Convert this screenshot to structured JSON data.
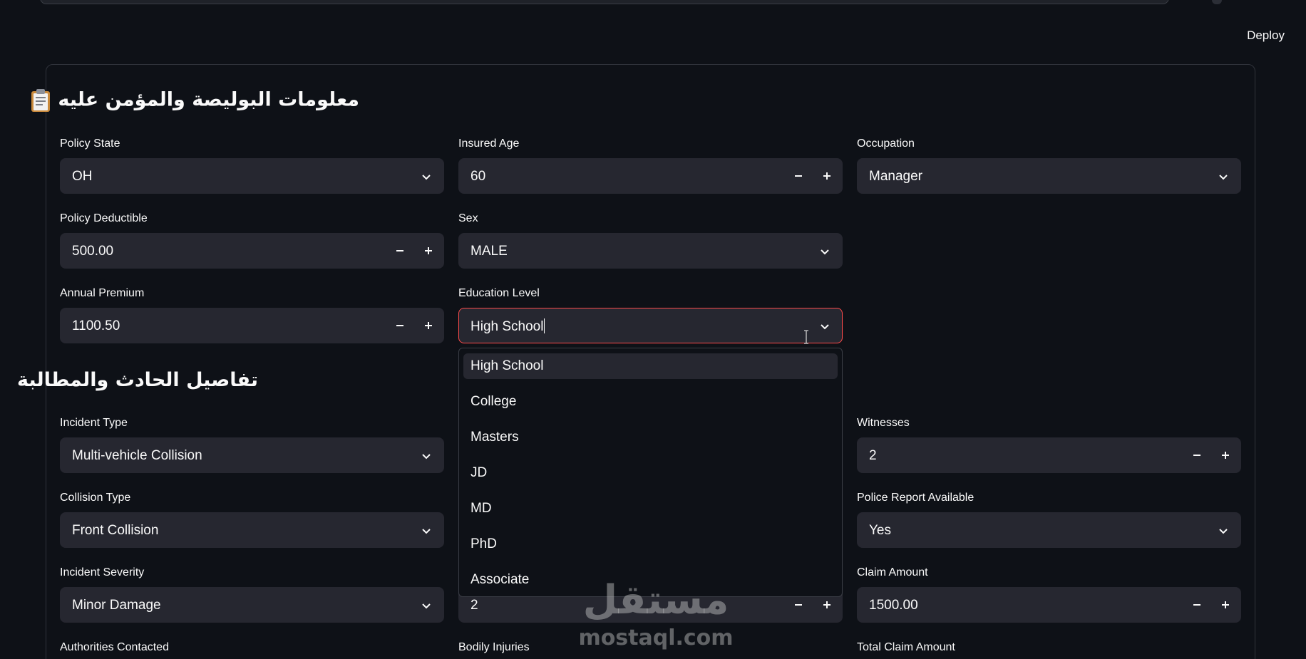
{
  "header": {
    "deploy_label": "Deploy"
  },
  "section1": {
    "title": "معلومات البوليصة والمؤمن عليه",
    "icon": "clipboard-icon"
  },
  "section2": {
    "title": "تفاصيل الحادث والمطالبة"
  },
  "fields": {
    "policy_state": {
      "label": "Policy State",
      "value": "OH"
    },
    "insured_age": {
      "label": "Insured Age",
      "value": "60"
    },
    "occupation": {
      "label": "Occupation",
      "value": "Manager"
    },
    "policy_deductible": {
      "label": "Policy Deductible",
      "value": "500.00"
    },
    "sex": {
      "label": "Sex",
      "value": "MALE"
    },
    "annual_premium": {
      "label": "Annual Premium",
      "value": "1100.50"
    },
    "education_level": {
      "label": "Education Level",
      "value": "High School"
    },
    "incident_type": {
      "label": "Incident Type",
      "value": "Multi-vehicle Collision"
    },
    "witnesses": {
      "label": "Witnesses",
      "value": "2"
    },
    "collision_type": {
      "label": "Collision Type",
      "value": "Front Collision"
    },
    "police_report": {
      "label": "Police Report Available",
      "value": "Yes"
    },
    "incident_severity": {
      "label": "Incident Severity",
      "value": "Minor Damage"
    },
    "hidden_number": {
      "value": "2"
    },
    "claim_amount": {
      "label": "Claim Amount",
      "value": "1500.00"
    },
    "authorities_contacted": {
      "label": "Authorities Contacted"
    },
    "bodily_injuries": {
      "label": "Bodily Injuries"
    },
    "total_claim_amount": {
      "label": "Total Claim Amount"
    }
  },
  "education_options": [
    "High School",
    "College",
    "Masters",
    "JD",
    "MD",
    "PhD",
    "Associate"
  ],
  "watermark": {
    "arabic": "مستقل",
    "latin": "mostaql.com"
  },
  "colors": {
    "background": "#0e1117",
    "input": "#262730",
    "focus": "#ff4b4b"
  }
}
